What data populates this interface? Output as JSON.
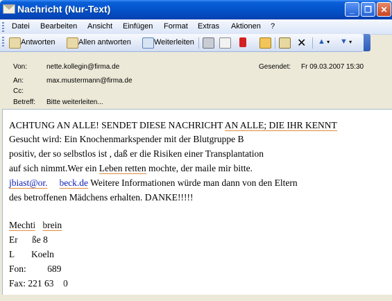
{
  "window": {
    "title": "Nachricht (Nur-Text)"
  },
  "menu": [
    "Datei",
    "Bearbeiten",
    "Ansicht",
    "Einfügen",
    "Format",
    "Extras",
    "Aktionen",
    "?"
  ],
  "toolbar": {
    "reply": "Antworten",
    "reply_all": "Allen antworten",
    "forward": "Weiterleiten"
  },
  "header": {
    "from_label": "Von:",
    "from_value": "nette.kollegin@firma.de",
    "sent_label": "Gesendet:",
    "sent_value": "Fr 09.03.2007 15:30",
    "to_label": "An:",
    "to_value": "max.mustermann@firma.de",
    "cc_label": "Cc:",
    "subject_label": "Betreff:",
    "subject_value": "Bitte weiterleiten..."
  },
  "body": {
    "line1a": "ACHTUNG AN ALLE! SENDET DIESE NACHRICHT ",
    "line1b": "AN ALLE; DIE IHR KENNT",
    "line2": "Gesucht wird: Ein Knochenmarkspender mit der Blutgruppe B",
    "line3": "positiv, der so selbstlos ist , daß er die Risiken einer Transplantation",
    "line4a": "auf sich nimmt.Wer ein ",
    "line4b": "Leben retten",
    "line4c": " mochte, der maile mir bitte.",
    "line5a": "jbiast@or.",
    "line5b": "beck.de",
    "line5c": " Weitere Informationen würde man dann von den Eltern",
    "line6": "des betroffenen Mädchens erhalten. DANKE!!!!!",
    "sig1a": "Mechti",
    "sig1b": "brein",
    "sig2": "Er",
    "sig2b": "ße 8",
    "sig3": "L",
    "sig3b": "Koeln",
    "sig4": "Fon: ",
    "sig4b": "689",
    "sig5": "Fax:  221 63",
    "sig5b": "0"
  }
}
